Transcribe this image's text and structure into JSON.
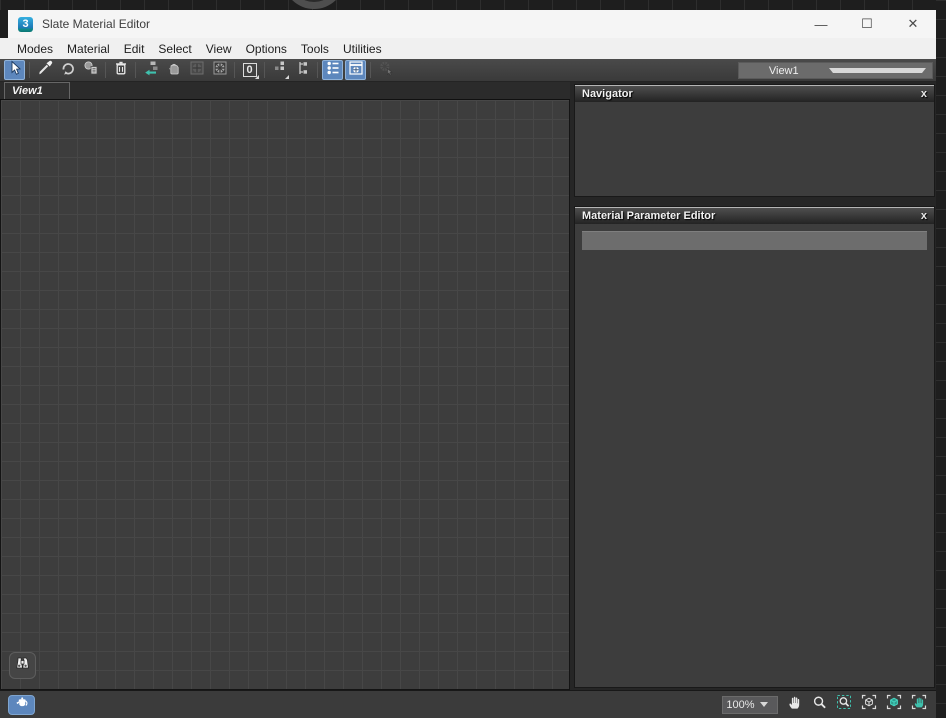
{
  "window": {
    "title": "Slate Material Editor",
    "app_icon_glyph": "3",
    "controls": {
      "minimize": "—",
      "maximize": "☐",
      "close": "✕"
    }
  },
  "menu": {
    "items": [
      "Modes",
      "Material",
      "Edit",
      "Select",
      "View",
      "Options",
      "Tools",
      "Utilities"
    ]
  },
  "toolbar": {
    "viewport_badge": "0",
    "view_selector": {
      "value": "View1"
    },
    "icons": [
      {
        "name": "select-tool",
        "state": "active"
      },
      {
        "name": "pick-material-from-object",
        "state": "normal"
      },
      {
        "name": "put-material-to-scene",
        "state": "normal"
      },
      {
        "name": "assign-material-to-selection",
        "state": "normal"
      },
      {
        "name": "delete-selected",
        "state": "normal"
      },
      {
        "name": "move-children",
        "state": "normal"
      },
      {
        "name": "hide-unused-nodeslots",
        "state": "normal"
      },
      {
        "name": "show-background-in-preview",
        "state": "normal"
      },
      {
        "name": "show-background",
        "state": "normal"
      },
      {
        "name": "show-shaded-material-in-viewport",
        "state": "normal"
      },
      {
        "name": "layout-all",
        "state": "normal"
      },
      {
        "name": "layout-children",
        "state": "normal"
      },
      {
        "name": "material-parameter-editor-toggle",
        "state": "active"
      },
      {
        "name": "navigator-toggle",
        "state": "active"
      },
      {
        "name": "select-by-material",
        "state": "disabled"
      }
    ]
  },
  "views": {
    "tabs": [
      {
        "label": "View1",
        "active": true
      }
    ]
  },
  "panels": {
    "navigator": {
      "title": "Navigator",
      "close_label": "x"
    },
    "material_parameter_editor": {
      "title": "Material Parameter Editor",
      "close_label": "x"
    }
  },
  "statusbar": {
    "render_preview_icon": "teapot",
    "zoom": {
      "value": "100%"
    },
    "tools": [
      "pan",
      "zoom",
      "zoom-region",
      "zoom-extents",
      "zoom-extents-selected",
      "pan-to-selected"
    ]
  },
  "colors": {
    "highlight_blue": "#5d87bd",
    "accent_teal": "#3fc1ae",
    "canvas_bg": "#3d3d3d",
    "titlebar_bg": "#f5f5f5"
  }
}
